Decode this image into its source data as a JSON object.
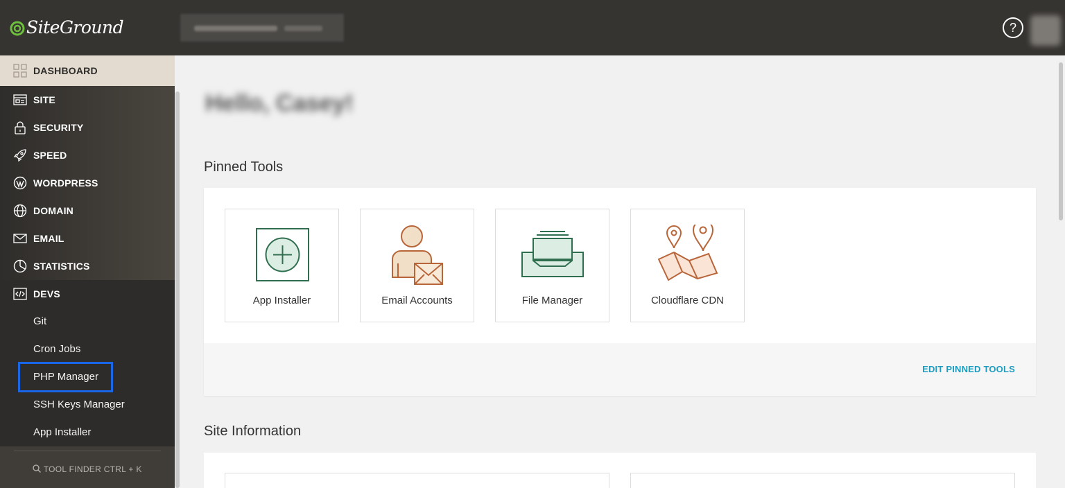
{
  "header": {
    "logo_text": "SiteGround",
    "help_glyph": "?"
  },
  "sidebar": {
    "items": [
      {
        "label": "DASHBOARD",
        "icon": "dashboard-icon"
      },
      {
        "label": "SITE",
        "icon": "site-icon"
      },
      {
        "label": "SECURITY",
        "icon": "lock-icon"
      },
      {
        "label": "SPEED",
        "icon": "rocket-icon"
      },
      {
        "label": "WORDPRESS",
        "icon": "wordpress-icon"
      },
      {
        "label": "DOMAIN",
        "icon": "globe-icon"
      },
      {
        "label": "EMAIL",
        "icon": "envelope-icon"
      },
      {
        "label": "STATISTICS",
        "icon": "pie-chart-icon"
      },
      {
        "label": "DEVS",
        "icon": "code-icon"
      }
    ],
    "devs_sub": [
      "Git",
      "Cron Jobs",
      "PHP Manager",
      "SSH Keys Manager",
      "App Installer"
    ],
    "tool_finder": "TOOL FINDER CTRL + K"
  },
  "main": {
    "pinned_title": "Pinned Tools",
    "tiles": [
      {
        "label": "App Installer",
        "icon": "plus-box-icon"
      },
      {
        "label": "Email Accounts",
        "icon": "user-mail-icon"
      },
      {
        "label": "File Manager",
        "icon": "file-tray-icon"
      },
      {
        "label": "Cloudflare CDN",
        "icon": "map-pins-icon"
      }
    ],
    "edit_pinned": "EDIT PINNED TOOLS",
    "site_info_title": "Site Information"
  },
  "colors": {
    "topbar": "#363431",
    "active_nav": "#e3dbcf",
    "highlight": "#1a66e8",
    "link": "#1d9cbf",
    "green_icon": "#2f6e4f",
    "orange_icon": "#b9653a"
  }
}
